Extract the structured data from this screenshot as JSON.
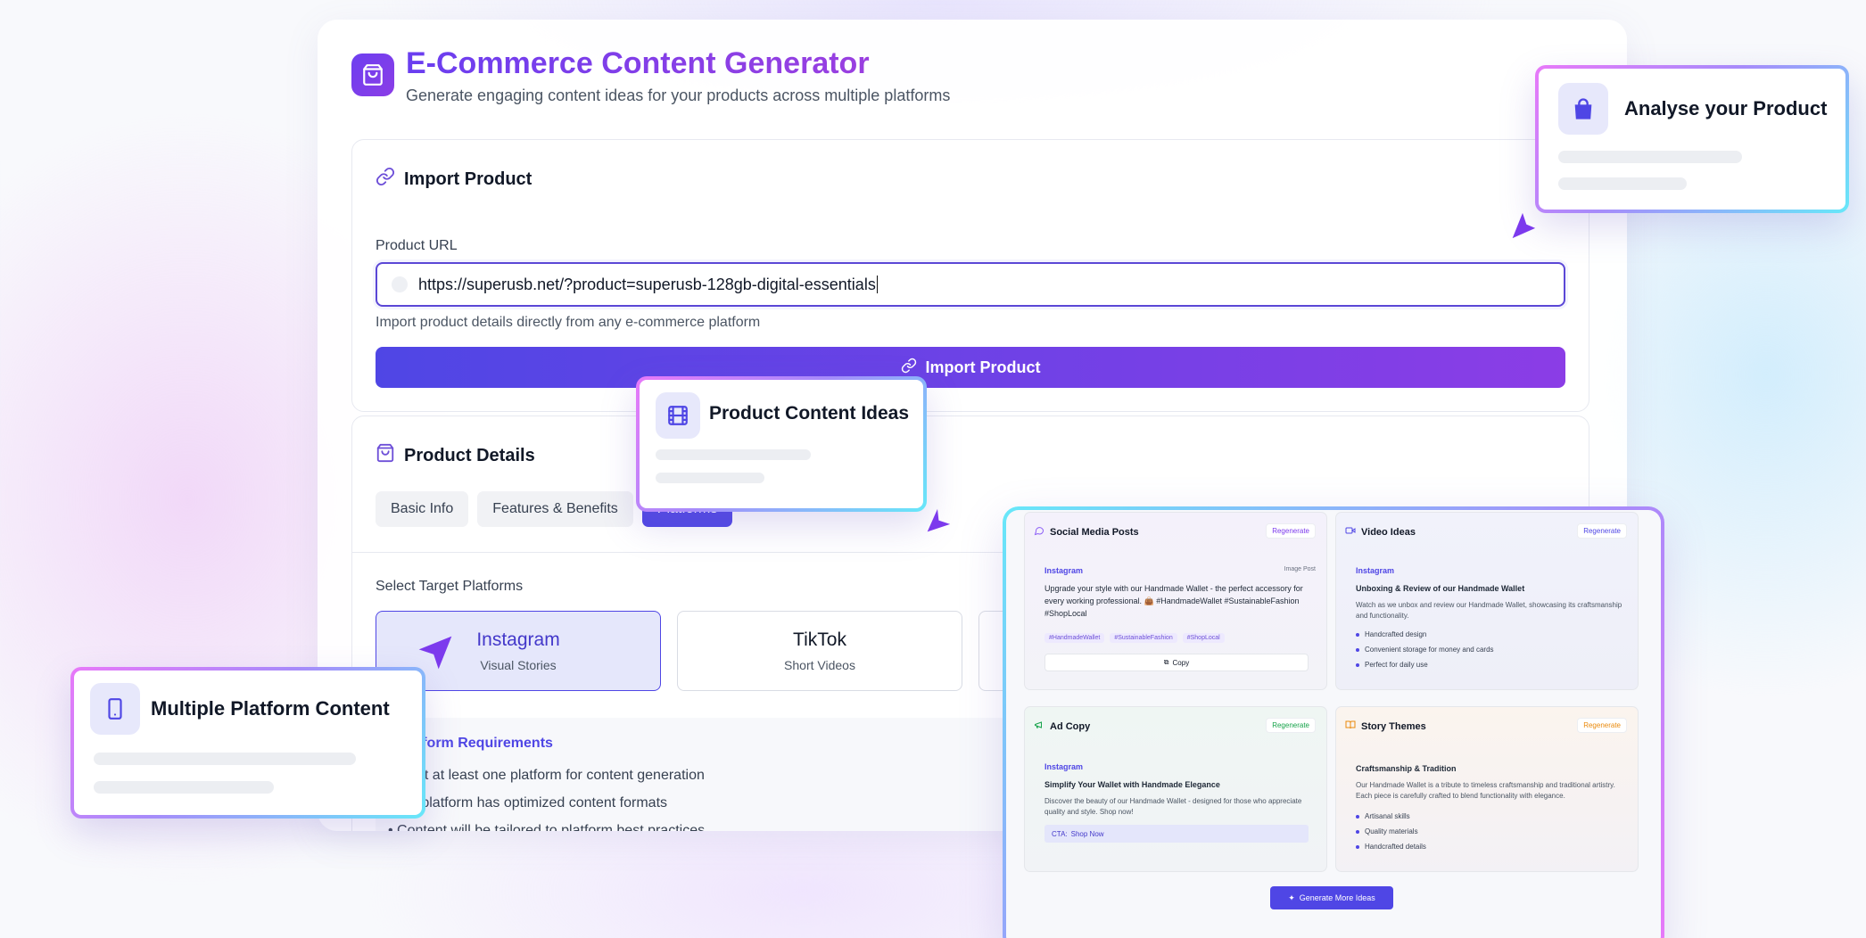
{
  "header": {
    "title": "E-Commerce Content Generator",
    "subtitle": "Generate engaging content ideas for your products across multiple platforms"
  },
  "import": {
    "heading": "Import Product",
    "field_label": "Product URL",
    "url_value": "https://superusb.net/?product=superusb-128gb-digital-essentials",
    "help_text": "Import product details directly from any e-commerce platform",
    "button_label": "Import Product"
  },
  "details": {
    "heading": "Product Details",
    "tabs": [
      {
        "label": "Basic Info",
        "active": false
      },
      {
        "label": "Features & Benefits",
        "active": false
      },
      {
        "label": "Platforms",
        "active": true
      }
    ],
    "platforms_label": "Select Target Platforms",
    "platforms": [
      {
        "name": "Instagram",
        "sub": "Visual Stories",
        "selected": true
      },
      {
        "name": "TikTok",
        "sub": "Short Videos",
        "selected": false
      }
    ],
    "requirements": {
      "title": "atform Requirements",
      "items": [
        "ect at least one platform for content generation",
        "h platform has optimized content formats",
        "• Content will be tailored to platform best practices"
      ]
    }
  },
  "floating": {
    "analyse": "Analyse your Product",
    "content_ideas": "Product Content Ideas",
    "multi_platform": "Multiple Platform Content"
  },
  "preview": {
    "social": {
      "title": "Social Media Posts",
      "regen": "Regenerate",
      "platform": "Instagram",
      "type": "Image Post",
      "text": "Upgrade your style with our Handmade Wallet - the perfect accessory for every working professional. 👜 #HandmadeWallet #SustainableFashion #ShopLocal",
      "tags": [
        "#HandmadeWallet",
        "#SustainableFashion",
        "#ShopLocal"
      ],
      "copy": "Copy"
    },
    "video": {
      "title": "Video Ideas",
      "regen": "Regenerate",
      "platform": "Instagram",
      "heading": "Unboxing & Review of our Handmade Wallet",
      "desc": "Watch as we unbox and review our Handmade Wallet, showcasing its craftsmanship and functionality.",
      "bullets": [
        "Handcrafted design",
        "Convenient storage for money and cards",
        "Perfect for daily use"
      ]
    },
    "ad": {
      "title": "Ad Copy",
      "regen": "Regenerate",
      "platform": "Instagram",
      "heading": "Simplify Your Wallet with Handmade Elegance",
      "desc": "Discover the beauty of our Handmade Wallet - designed for those who appreciate quality and style. Shop now!",
      "cta_label": "CTA:",
      "cta_value": "Shop Now"
    },
    "story": {
      "title": "Story Themes",
      "regen": "Regenerate",
      "heading": "Craftsmanship & Tradition",
      "desc": "Our Handmade Wallet is a tribute to timeless craftsmanship and traditional artistry. Each piece is carefully crafted to blend functionality with elegance.",
      "bullets": [
        "Artisanal skills",
        "Quality materials",
        "Handcrafted details"
      ]
    },
    "more_button": "Generate More Ideas"
  },
  "colors": {
    "primary": "#4f46e5",
    "accent": "#8b3de6",
    "cursor": "#7c3aed"
  }
}
